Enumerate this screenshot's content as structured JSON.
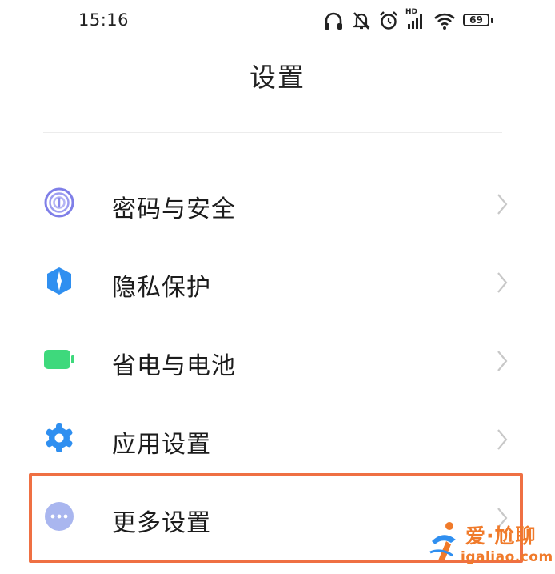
{
  "status_bar": {
    "time": "15:16",
    "hd_label": "HD",
    "battery_level": "69",
    "icons": [
      "headphones-icon",
      "mute-icon",
      "alarm-icon",
      "cellular-signal-icon",
      "wifi-icon",
      "battery-icon"
    ]
  },
  "header": {
    "title": "设置"
  },
  "settings": {
    "items": [
      {
        "label": "密码与安全",
        "icon": "fingerprint-icon",
        "icon_color": "#7f7fe8"
      },
      {
        "label": "隐私保护",
        "icon": "privacy-shield-icon",
        "icon_color": "#2f8ff0"
      },
      {
        "label": "省电与电池",
        "icon": "battery-icon",
        "icon_color": "#3ed97c"
      },
      {
        "label": "应用设置",
        "icon": "gear-icon",
        "icon_color": "#2f8ff0"
      },
      {
        "label": "更多设置",
        "icon": "more-dots-icon",
        "icon_color": "#a9b6ef"
      }
    ]
  },
  "highlight": {
    "target": "更多设置",
    "color": "#ef7043"
  },
  "watermark": {
    "name": "爱·尬聊",
    "url": "igaliao.com",
    "color": "#f07a2a"
  }
}
